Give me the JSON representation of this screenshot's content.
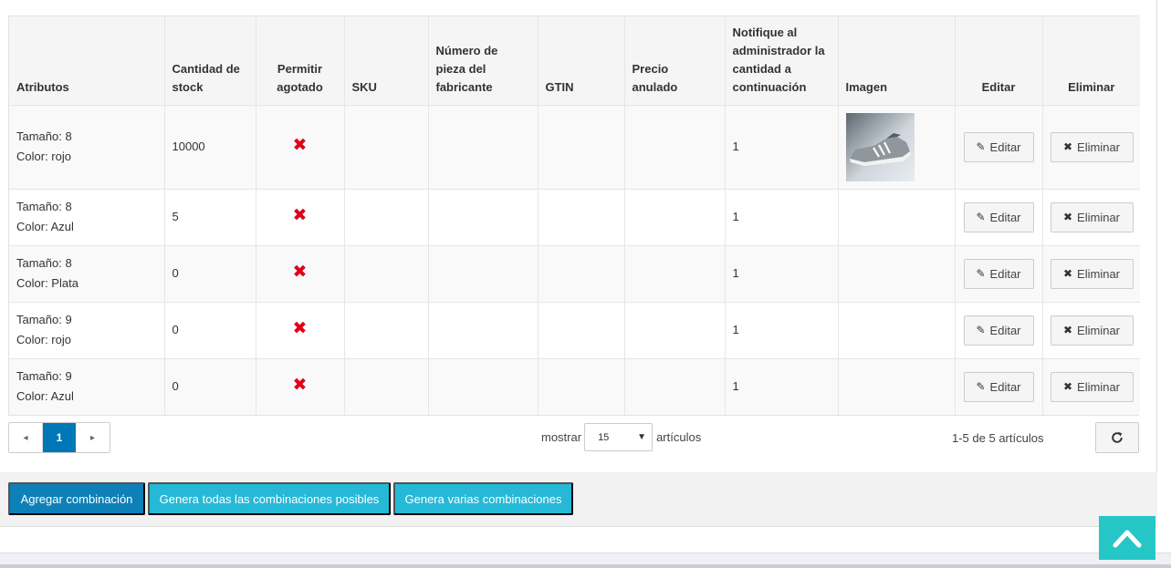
{
  "table": {
    "headers": {
      "attributes": "Atributos",
      "stock": "Cantidad de stock",
      "allow_oos": "Permitir agotado",
      "sku": "SKU",
      "mpn": "Número de pieza del fabricante",
      "gtin": "GTIN",
      "override_price": "Precio anulado",
      "notify_admin": "Notifique al administrador la cantidad a continuación",
      "image": "Imagen",
      "edit": "Editar",
      "delete": "Eliminar"
    },
    "rows": [
      {
        "size": "Tamaño: 8",
        "color": "Color: rojo",
        "stock": "10000",
        "allow_oos": "✖",
        "sku": "",
        "mpn": "",
        "gtin": "",
        "override_price": "",
        "notify": "1",
        "has_image": true
      },
      {
        "size": "Tamaño: 8",
        "color": "Color: Azul",
        "stock": "5",
        "allow_oos": "✖",
        "sku": "",
        "mpn": "",
        "gtin": "",
        "override_price": "",
        "notify": "1",
        "has_image": false
      },
      {
        "size": "Tamaño: 8",
        "color": "Color: Plata",
        "stock": "0",
        "allow_oos": "✖",
        "sku": "",
        "mpn": "",
        "gtin": "",
        "override_price": "",
        "notify": "1",
        "has_image": false
      },
      {
        "size": "Tamaño: 9",
        "color": "Color: rojo",
        "stock": "0",
        "allow_oos": "✖",
        "sku": "",
        "mpn": "",
        "gtin": "",
        "override_price": "",
        "notify": "1",
        "has_image": false
      },
      {
        "size": "Tamaño: 9",
        "color": "Color: Azul",
        "stock": "0",
        "allow_oos": "✖",
        "sku": "",
        "mpn": "",
        "gtin": "",
        "override_price": "",
        "notify": "1",
        "has_image": false
      }
    ],
    "edit_label": "Editar",
    "delete_label": "Eliminar",
    "edit_icon": "pencil-icon",
    "delete_icon": "times-icon",
    "oos_icon": "x-mark-icon",
    "oos_color": "#e0001a"
  },
  "pagination": {
    "prev_icon": "◂",
    "current_page": "1",
    "next_icon": "▸",
    "show_label": "mostrar",
    "per_page_value": "15",
    "items_label": "artículos",
    "count_text": "1-5 de 5 artículos",
    "refresh_icon": "refresh-icon"
  },
  "actions": {
    "add_combination": "Agregar combinación",
    "generate_all": "Genera todas las combinaciones posibles",
    "generate_several": "Genera varias combinaciones"
  },
  "colors": {
    "primary": "#0d80b8",
    "info": "#25b9d7",
    "scroll_top": "#25c6c6",
    "page_active": "#0077b6"
  }
}
